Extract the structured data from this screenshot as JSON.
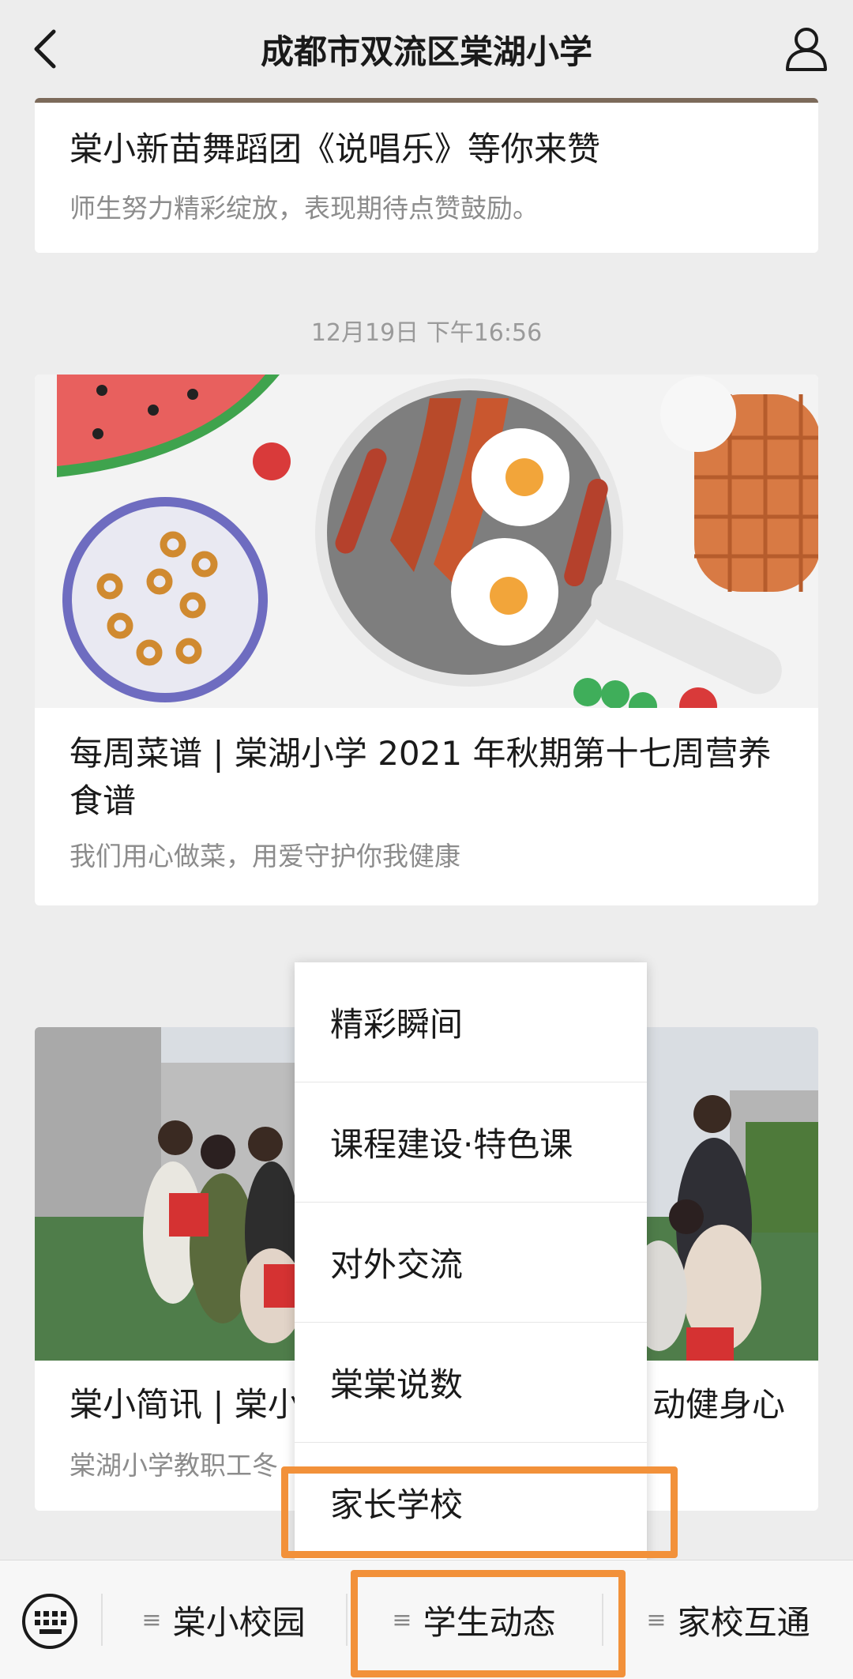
{
  "header": {
    "title": "成都市双流区棠湖小学"
  },
  "articles": [
    {
      "title": "棠小新苗舞蹈团《说唱乐》等你来赞",
      "desc": "师生努力精彩绽放，表现期待点赞鼓励。"
    },
    {
      "title": "每周菜谱 | 棠湖小学 2021 年秋期第十七周营养食谱",
      "desc": "我们用心做菜，用爱守护你我健康"
    },
    {
      "title_left": "棠小简讯 | 棠小",
      "title_right": "动健身心",
      "desc": "棠湖小学教职工冬"
    }
  ],
  "timestamp": "12月19日 下午16:56",
  "popup_menu": {
    "items": [
      "精彩瞬间",
      "课程建设·特色课",
      "对外交流",
      "棠棠说数",
      "家长学校"
    ]
  },
  "bottom_menu": {
    "tabs": [
      "棠小校园",
      "学生动态",
      "家校互通"
    ]
  },
  "colors": {
    "highlight": "#f2913a",
    "background": "#ededed"
  }
}
